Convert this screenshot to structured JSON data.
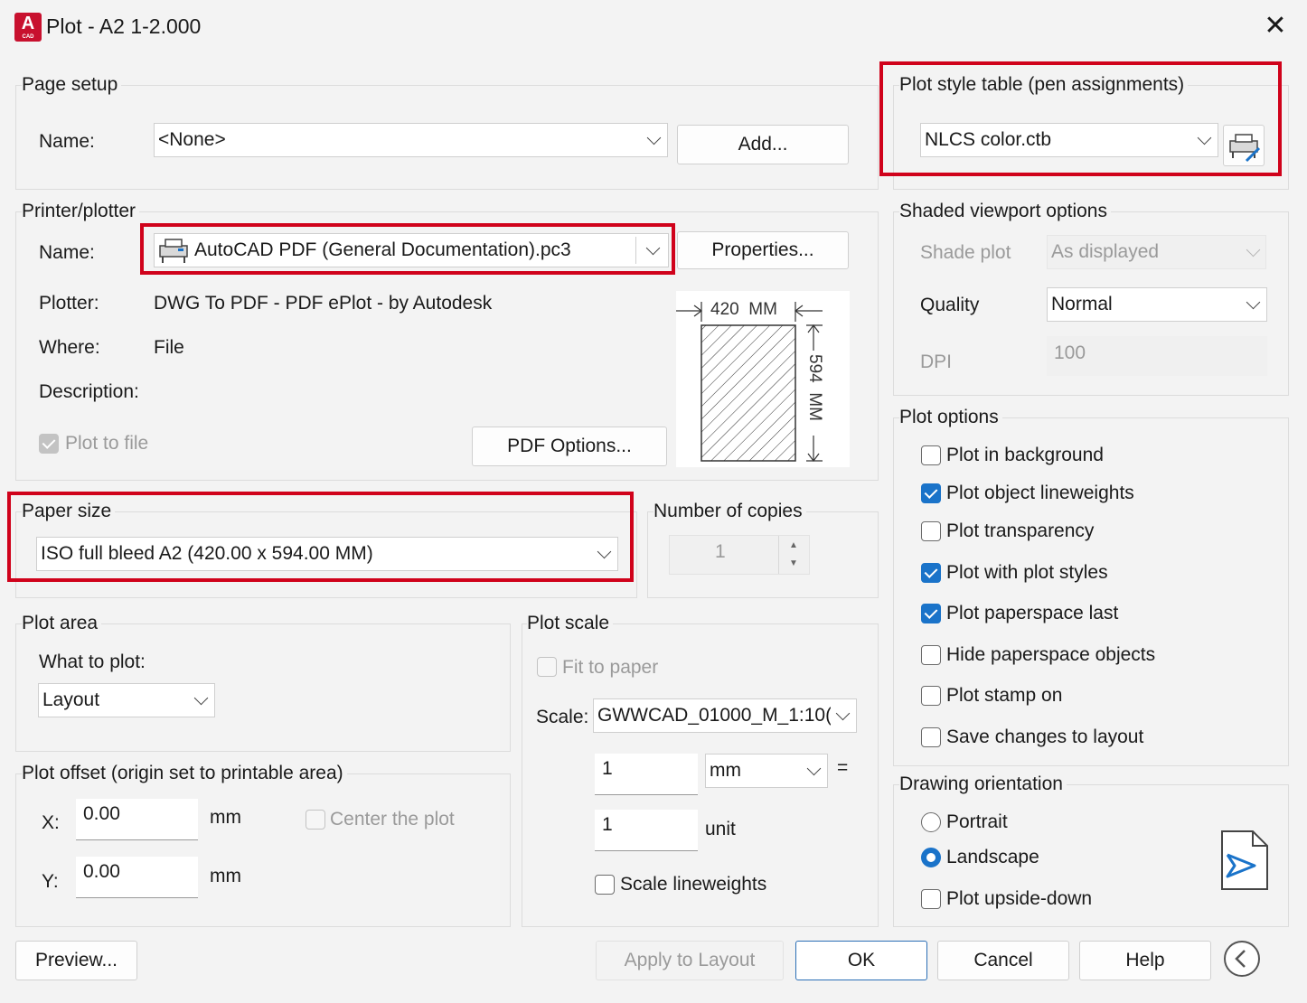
{
  "window": {
    "title": "Plot - A2 1-2.000",
    "app_icon": "autocad-icon",
    "app_icon_letter": "A",
    "app_icon_sub": "CAD"
  },
  "page_setup": {
    "legend": "Page setup",
    "name_label": "Name:",
    "name_value": "<None>",
    "add_button": "Add..."
  },
  "printer": {
    "legend": "Printer/plotter",
    "name_label": "Name:",
    "name_value": "AutoCAD PDF (General Documentation).pc3",
    "properties_button": "Properties...",
    "plotter_label": "Plotter:",
    "plotter_value": "DWG To PDF - PDF ePlot - by Autodesk",
    "where_label": "Where:",
    "where_value": "File",
    "description_label": "Description:",
    "plot_to_file_label": "Plot to file",
    "pdf_options_button": "PDF Options...",
    "preview_width": "420  MM",
    "preview_height": "594  MM"
  },
  "paper_size": {
    "legend": "Paper size",
    "value": "ISO full bleed A2 (420.00 x 594.00 MM)"
  },
  "copies": {
    "legend": "Number of copies",
    "value": "1"
  },
  "plot_area": {
    "legend": "Plot area",
    "what_label": "What to plot:",
    "what_value": "Layout"
  },
  "plot_offset": {
    "legend": "Plot offset (origin set to printable area)",
    "x_label": "X:",
    "x_value": "0.00",
    "x_unit": "mm",
    "y_label": "Y:",
    "y_value": "0.00",
    "y_unit": "mm",
    "center_label": "Center the plot"
  },
  "plot_scale": {
    "legend": "Plot scale",
    "fit_label": "Fit to paper",
    "scale_label": "Scale:",
    "scale_value": "GWWCAD_01000_M_1:10(",
    "value1": "1",
    "unit1": "mm",
    "equals": "=",
    "value2": "1",
    "unit2": "unit",
    "lineweights_label": "Scale lineweights"
  },
  "plot_style": {
    "legend": "Plot style table (pen assignments)",
    "value": "NLCS color.ctb",
    "edit_icon": "plotter-edit-icon"
  },
  "shaded": {
    "legend": "Shaded viewport options",
    "shade_label": "Shade plot",
    "shade_value": "As displayed",
    "quality_label": "Quality",
    "quality_value": "Normal",
    "dpi_label": "DPI",
    "dpi_value": "100"
  },
  "plot_options": {
    "legend": "Plot options",
    "items": [
      {
        "label": "Plot in background",
        "checked": false
      },
      {
        "label": "Plot object lineweights",
        "checked": true
      },
      {
        "label": "Plot transparency",
        "checked": false
      },
      {
        "label": "Plot with plot styles",
        "checked": true
      },
      {
        "label": "Plot paperspace last",
        "checked": true
      },
      {
        "label": "Hide paperspace objects",
        "checked": false
      },
      {
        "label": "Plot stamp on",
        "checked": false
      },
      {
        "label": "Save changes to layout",
        "checked": false
      }
    ]
  },
  "orientation": {
    "legend": "Drawing orientation",
    "portrait": "Portrait",
    "landscape": "Landscape",
    "selected": "landscape",
    "upside_down": "Plot upside-down",
    "preview_icon": "landscape-orientation-icon"
  },
  "footer": {
    "preview_button": "Preview...",
    "apply_button": "Apply to Layout",
    "ok_button": "OK",
    "cancel_button": "Cancel",
    "help_button": "Help",
    "collapse_icon": "collapse-chevron-icon"
  },
  "colors": {
    "accent": "#1a73c9",
    "highlight_red": "#d0021b",
    "app_red": "#c8102e"
  }
}
